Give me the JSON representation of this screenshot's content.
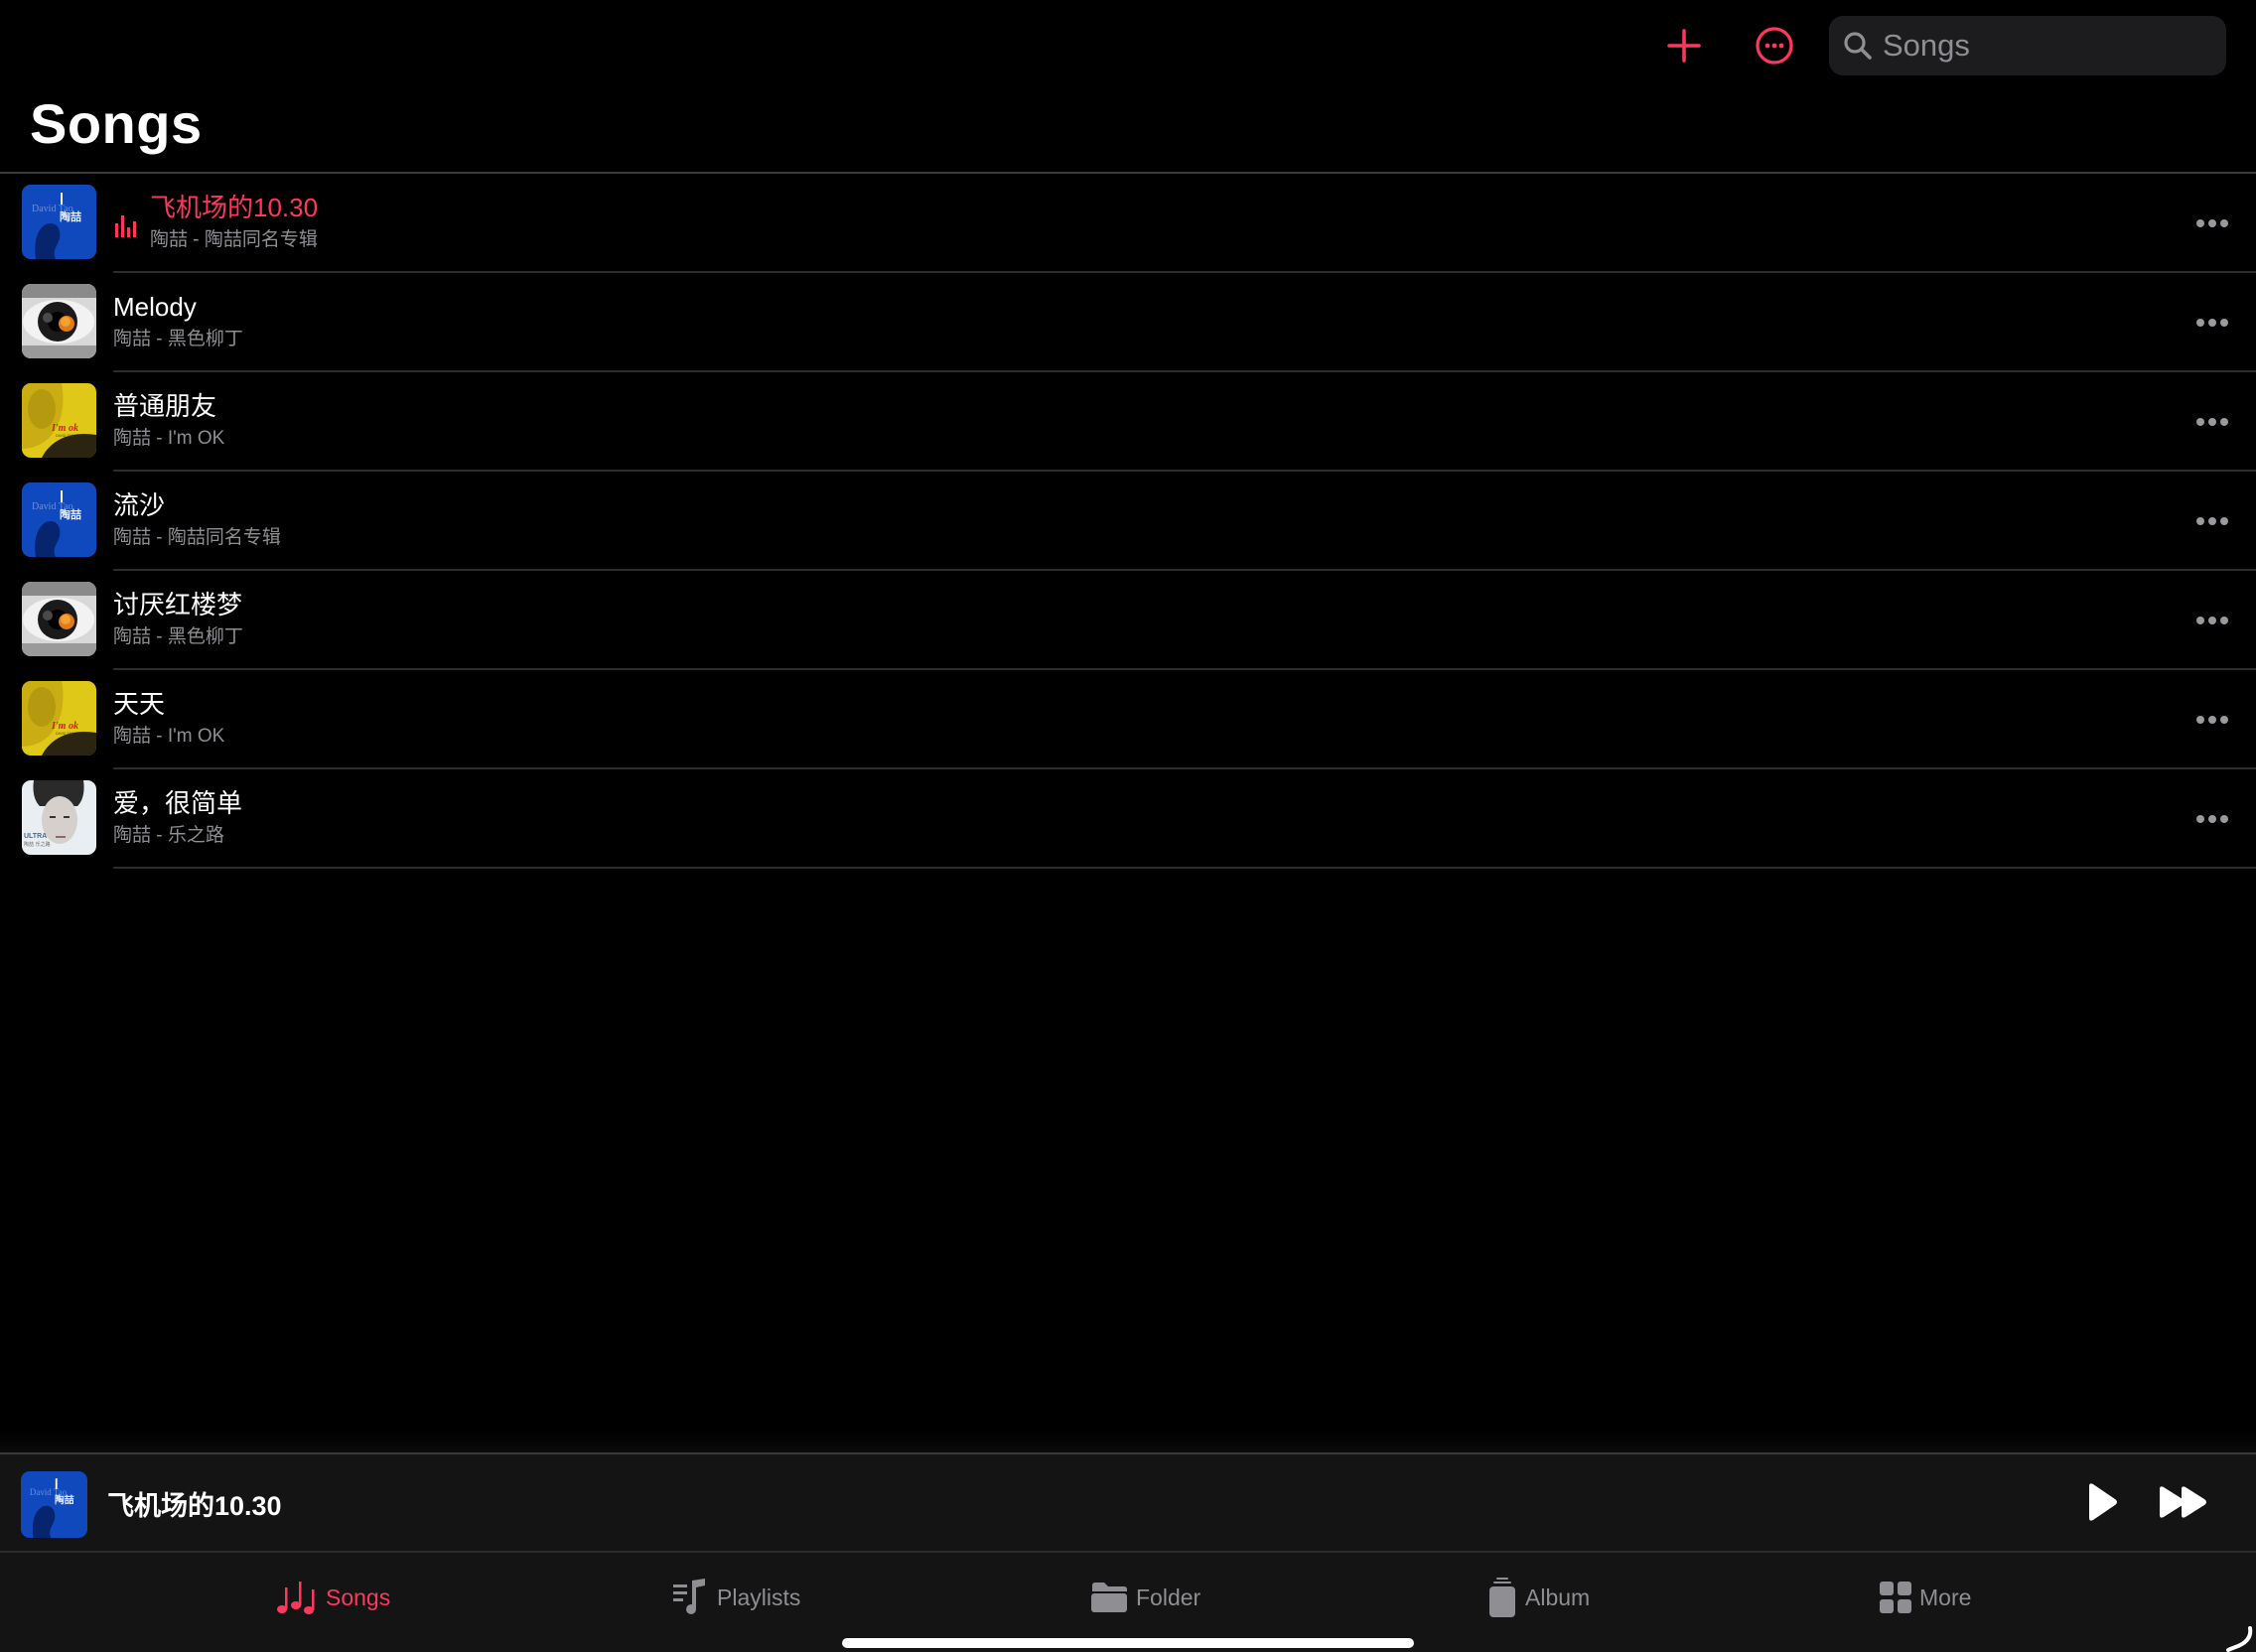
{
  "header": {
    "add_icon": "plus-icon",
    "more_icon": "ellipsis-circle-icon",
    "search": {
      "icon": "magnifying-glass-icon",
      "placeholder": "Songs",
      "value": ""
    },
    "title": "Songs"
  },
  "colors": {
    "accent": "#ff375f",
    "background": "#000000",
    "secondary_text": "#8e8e93",
    "bar_background": "#141414"
  },
  "songs": [
    {
      "title": "飞机场的10.30",
      "subtitle": "陶喆 - 陶喆同名专辑",
      "artist": "陶喆",
      "album": "陶喆同名专辑",
      "art": "blue-portrait-album-art",
      "playing": true
    },
    {
      "title": "Melody",
      "subtitle": "陶喆 - 黑色柳丁",
      "artist": "陶喆",
      "album": "黑色柳丁",
      "art": "eye-album-art",
      "playing": false
    },
    {
      "title": "普通朋友",
      "subtitle": "陶喆 - I'm OK",
      "artist": "陶喆",
      "album": "I'm OK",
      "art": "yellow-portrait-album-art",
      "playing": false
    },
    {
      "title": "流沙",
      "subtitle": "陶喆 - 陶喆同名专辑",
      "artist": "陶喆",
      "album": "陶喆同名专辑",
      "art": "blue-portrait-album-art",
      "playing": false
    },
    {
      "title": "讨厌红楼梦",
      "subtitle": "陶喆 - 黑色柳丁",
      "artist": "陶喆",
      "album": "黑色柳丁",
      "art": "eye-album-art",
      "playing": false
    },
    {
      "title": "天天",
      "subtitle": "陶喆 - I'm OK",
      "artist": "陶喆",
      "album": "I'm OK",
      "art": "yellow-portrait-album-art",
      "playing": false
    },
    {
      "title": "爱，很简单",
      "subtitle": "陶喆 - 乐之路",
      "artist": "陶喆",
      "album": "乐之路",
      "art": "white-portrait-album-art",
      "playing": false
    }
  ],
  "now_playing": {
    "title": "飞机场的10.30",
    "art": "blue-portrait-album-art",
    "play_icon": "play-icon",
    "next_icon": "forward-icon"
  },
  "tabs": [
    {
      "label": "Songs",
      "icon": "music-notes-icon",
      "active": true
    },
    {
      "label": "Playlists",
      "icon": "music-list-icon",
      "active": false
    },
    {
      "label": "Folder",
      "icon": "folder-icon",
      "active": false
    },
    {
      "label": "Album",
      "icon": "album-stack-icon",
      "active": false
    },
    {
      "label": "More",
      "icon": "grid-icon",
      "active": false
    }
  ]
}
